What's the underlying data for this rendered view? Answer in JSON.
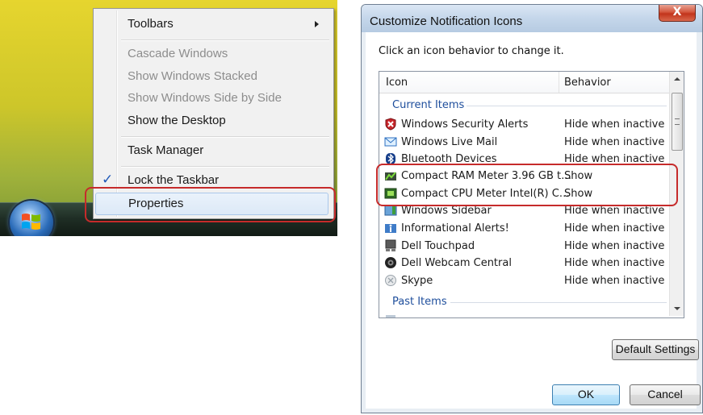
{
  "context_menu": {
    "items": [
      {
        "label": "Toolbars",
        "enabled": true,
        "has_submenu": true
      },
      {
        "label": "Cascade Windows",
        "enabled": false
      },
      {
        "label": "Show Windows Stacked",
        "enabled": false
      },
      {
        "label": "Show Windows Side by Side",
        "enabled": false
      },
      {
        "label": "Show the Desktop",
        "enabled": true
      },
      {
        "label": "Task Manager",
        "enabled": true
      },
      {
        "label": "Lock the Taskbar",
        "enabled": true,
        "checked": true
      },
      {
        "label": "Properties",
        "enabled": true,
        "highlighted": true
      }
    ],
    "check_glyph": "✓"
  },
  "dialog": {
    "title": "Customize Notification Icons",
    "close_glyph": "X",
    "instruction": "Click an icon behavior to change it.",
    "columns": {
      "icon": "Icon",
      "behavior": "Behavior"
    },
    "groups": {
      "current": "Current Items",
      "past": "Past Items"
    },
    "rows": [
      {
        "name": "Windows Security Alerts",
        "behavior": "Hide when inactive",
        "icon": "security-shield-icon"
      },
      {
        "name": "Windows Live Mail",
        "behavior": "Hide when inactive",
        "icon": "mail-icon"
      },
      {
        "name": "Bluetooth Devices",
        "behavior": "Hide when inactive",
        "icon": "bluetooth-icon"
      },
      {
        "name": "Compact RAM Meter 3.96 GB t…",
        "behavior": "Show",
        "icon": "ram-meter-icon"
      },
      {
        "name": "Compact CPU Meter Intel(R) C…",
        "behavior": "Show",
        "icon": "cpu-meter-icon"
      },
      {
        "name": "Windows Sidebar",
        "behavior": "Hide when inactive",
        "icon": "sidebar-icon"
      },
      {
        "name": "Informational Alerts!",
        "behavior": "Hide when inactive",
        "icon": "info-alert-icon"
      },
      {
        "name": "Dell Touchpad",
        "behavior": "Hide when inactive",
        "icon": "touchpad-icon"
      },
      {
        "name": "Dell Webcam Central",
        "behavior": "Hide when inactive",
        "icon": "webcam-icon"
      },
      {
        "name": "Skype",
        "behavior": "Hide when inactive",
        "icon": "skype-icon"
      }
    ],
    "buttons": {
      "default_settings": "Default Settings",
      "ok": "OK",
      "cancel": "Cancel"
    }
  },
  "colors": {
    "highlight_ring": "#c62b2b",
    "group_header": "#1e4e9c"
  }
}
